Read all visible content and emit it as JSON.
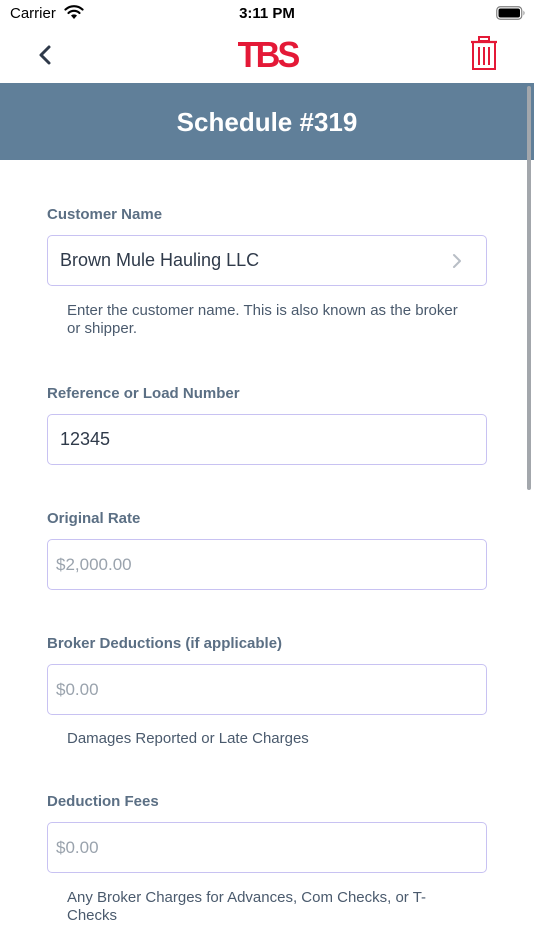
{
  "status_bar": {
    "carrier": "Carrier",
    "time": "3:11 PM"
  },
  "nav": {
    "logo": "TBS",
    "back_icon": "chevron-left-icon",
    "trash_icon": "trash-icon",
    "accent_color": "#e41937"
  },
  "header": {
    "title": "Schedule #319",
    "background_color": "#607f99"
  },
  "form": {
    "customer_name": {
      "label": "Customer Name",
      "value": "Brown Mule Hauling LLC",
      "help": "Enter the customer name. This is also known as the broker or shipper."
    },
    "reference": {
      "label": "Reference or Load Number",
      "value": "12345"
    },
    "original_rate": {
      "label": "Original Rate",
      "placeholder": "$2,000.00"
    },
    "broker_deductions": {
      "label": "Broker Deductions (if applicable)",
      "placeholder": "$0.00",
      "help": "Damages Reported or Late Charges"
    },
    "deduction_fees": {
      "label": "Deduction Fees",
      "placeholder": "$0.00",
      "help": "Any Broker Charges for Advances, Com Checks, or T-Checks"
    }
  }
}
